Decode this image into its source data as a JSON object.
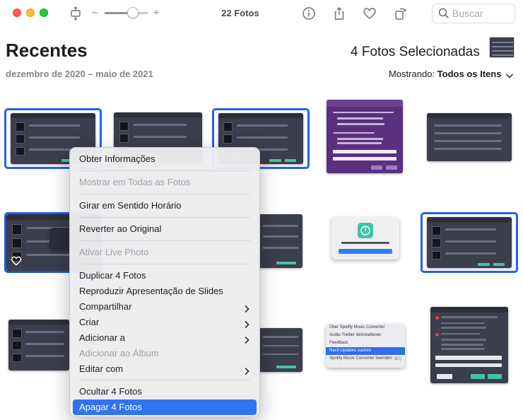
{
  "toolbar": {
    "title": "22 Fotos",
    "zoom_minus": "–",
    "zoom_plus": "+",
    "zoom_level": 0.55,
    "search_placeholder": "Buscar"
  },
  "header": {
    "title": "Recentes",
    "selection_count": "4 Fotos Selecionadas",
    "date_range": "dezembro de 2020 – maio de 2021",
    "filter_label": "Mostrando:",
    "filter_value": "Todos os Itens"
  },
  "context_menu": {
    "items": [
      {
        "label": "Obter Informações",
        "enabled": true
      },
      {
        "label": "Mostrar em Todas as Fotos",
        "enabled": false
      },
      {
        "label": "Girar em Sentido Horário",
        "enabled": true
      },
      {
        "label": "Reverter ao Original",
        "enabled": true
      },
      {
        "label": "Ativar Live Photo",
        "enabled": false
      },
      {
        "label": "Duplicar 4 Fotos",
        "enabled": true
      },
      {
        "label": "Reproduzir Apresentação de Slides",
        "enabled": true
      },
      {
        "label": "Compartilhar",
        "enabled": true,
        "submenu": true
      },
      {
        "label": "Criar",
        "enabled": true,
        "submenu": true
      },
      {
        "label": "Adicionar a",
        "enabled": true,
        "submenu": true
      },
      {
        "label": "Adicionar ao Álbum",
        "enabled": false
      },
      {
        "label": "Editar com",
        "enabled": true,
        "submenu": true
      },
      {
        "label": "Ocultar 4 Fotos",
        "enabled": true
      },
      {
        "label": "Apagar 4 Fotos",
        "enabled": true,
        "highlighted": true
      }
    ]
  },
  "thumb_menu": {
    "items": [
      "Über Spotify Music Converter",
      "Audio-Treiber deinstallieren",
      "Feedback",
      "Nach Updates suchen",
      "Spotify Music Converter beenden"
    ],
    "shortcut": "⌘Q"
  },
  "colors": {
    "selection_border": "#2562e8",
    "menu_highlight": "#2f74ef",
    "accent_green": "#3fc5a6"
  }
}
